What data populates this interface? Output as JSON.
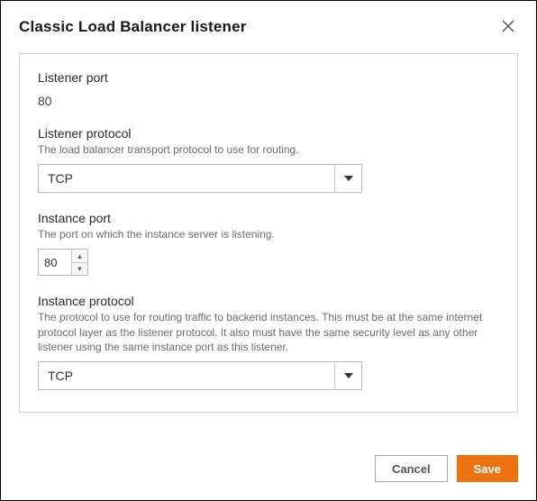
{
  "dialog": {
    "title": "Classic Load Balancer listener"
  },
  "fields": {
    "listener_port": {
      "label": "Listener port",
      "value": "80"
    },
    "listener_protocol": {
      "label": "Listener protocol",
      "description": "The load balancer transport protocol to use for routing.",
      "value": "TCP"
    },
    "instance_port": {
      "label": "Instance port",
      "description": "The port on which the instance server is listening.",
      "value": "80"
    },
    "instance_protocol": {
      "label": "Instance protocol",
      "description": "The protocol to use for routing traffic to backend instances. This must be at the same internet protocol layer as the listener protocol. It also must have the same security level as any other listener using the same instance port as this listener.",
      "value": "TCP"
    }
  },
  "footer": {
    "cancel": "Cancel",
    "save": "Save"
  }
}
